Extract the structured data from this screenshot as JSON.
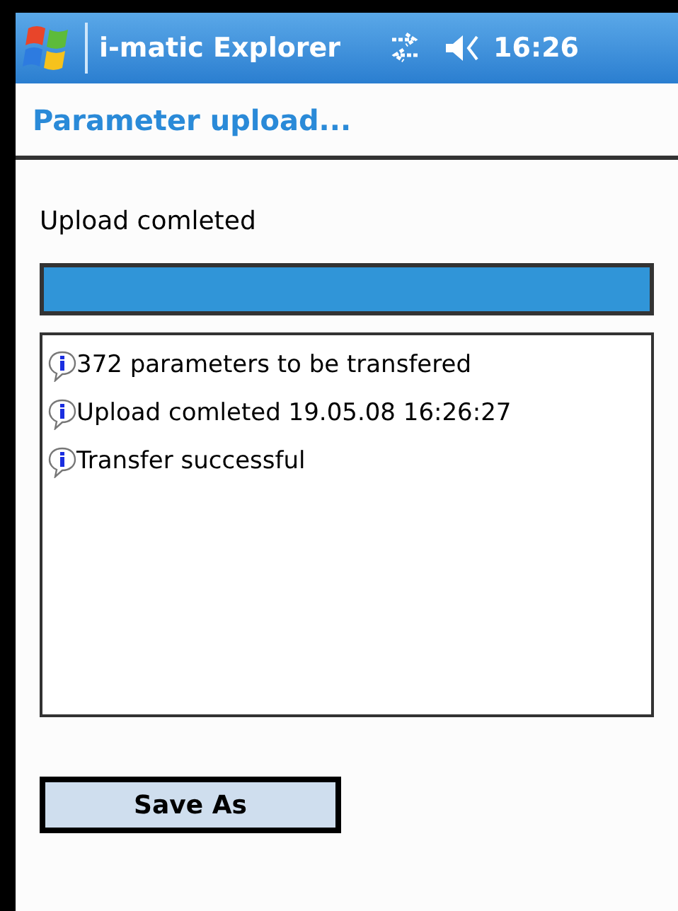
{
  "status_bar": {
    "title": "i-matic Explorer",
    "time": "16:26"
  },
  "header": {
    "title": "Parameter upload..."
  },
  "status_text": "Upload comleted",
  "progress": {
    "level": 1
  },
  "log": [
    {
      "kind": "info",
      "text": "372 parameters to be transfered"
    },
    {
      "kind": "info",
      "text": "Upload comleted 19.05.08 16:26:27"
    },
    {
      "kind": "info",
      "text": "Transfer successful"
    }
  ],
  "buttons": [
    "Save As"
  ]
}
